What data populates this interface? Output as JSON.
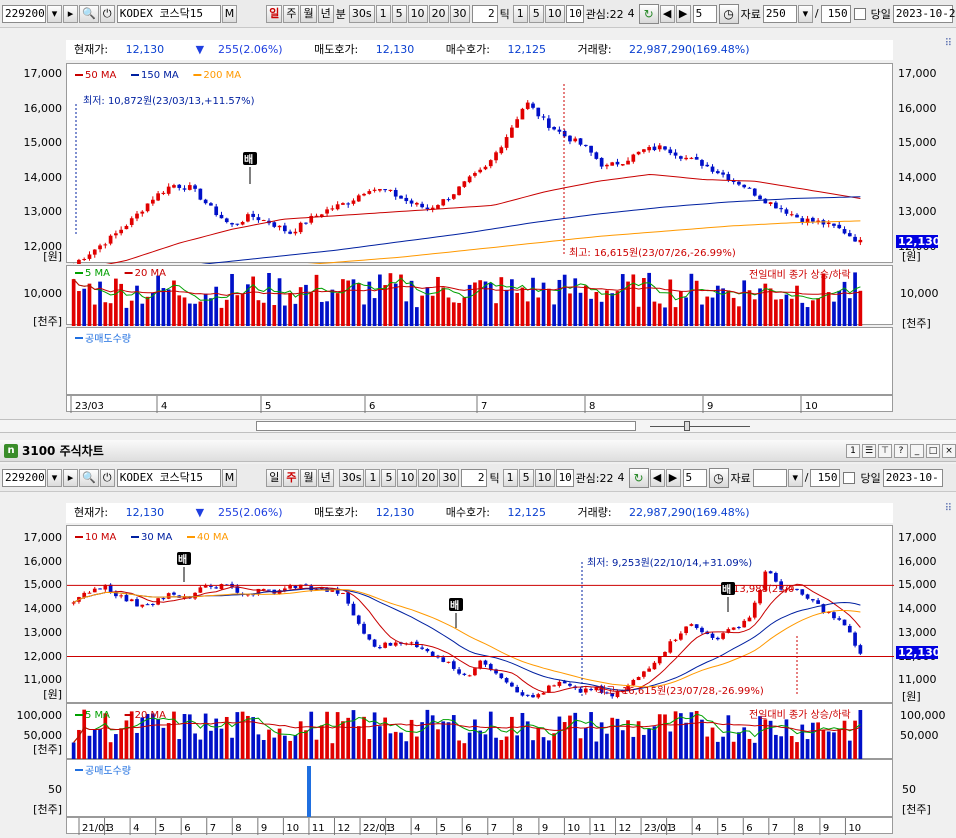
{
  "toolbar": {
    "code": "229200",
    "name": "KODEX 코스닥15",
    "periods": [
      "일",
      "주",
      "월",
      "년"
    ],
    "unit_min": "분",
    "mins": [
      "30s",
      "1",
      "5",
      "10",
      "20",
      "30"
    ],
    "tick_value": "2",
    "tick_label": "틱",
    "ticks": [
      "1",
      "5",
      "10"
    ],
    "interest_label": "관심:22",
    "interest_sub": "4",
    "count": "5",
    "data_label": "자료",
    "data_value": "250",
    "slash": "/",
    "display_value": "150",
    "today": "당일",
    "date": "2023-10-2"
  },
  "toolbar2": {
    "count": "5",
    "data_label": "자료",
    "display_value": "150",
    "date": "2023-10-"
  },
  "info": {
    "price_label": "현재가:",
    "price": "12,130",
    "change": "255(2.06%)",
    "ask_label": "매도호가:",
    "ask": "12,130",
    "bid_label": "매수호가:",
    "bid": "12,125",
    "vol_label": "거래량:",
    "vol": "22,987,290(169.48%)"
  },
  "window_title": "3100 주식차트",
  "window_logo": "n",
  "top": {
    "legend": [
      {
        "name": "50 MA",
        "color": "#c80000"
      },
      {
        "name": "150 MA",
        "color": "#0020a0"
      },
      {
        "name": "200 MA",
        "color": "#ff9900"
      }
    ],
    "low_note": "최저: 10,872원(23/03/13,+11.57%)",
    "high_note": "최고: 16,615원(23/07/26,-26.99%)",
    "yticks": [
      "17,000",
      "16,000",
      "15,000",
      "14,000",
      "13,000",
      "12,000"
    ],
    "unit": "[원]",
    "price_tag": "12,130",
    "vol_legend": [
      {
        "name": "5 MA",
        "color": "#00a000"
      },
      {
        "name": "20 MA",
        "color": "#c80000"
      }
    ],
    "vol_note": "전일대비 종가 상승/하락",
    "vol_tick": "10,000",
    "vol_unit": "[천주]",
    "short_label": "공매도수량",
    "xlabels": [
      "23/03",
      "4",
      "5",
      "6",
      "7",
      "8",
      "9",
      "10"
    ],
    "marker": "배"
  },
  "bottom": {
    "legend": [
      {
        "name": "10 MA",
        "color": "#c80000"
      },
      {
        "name": "30 MA",
        "color": "#0020a0"
      },
      {
        "name": "40 MA",
        "color": "#ff9900"
      }
    ],
    "low_note": "최저: 9,253원(22/10/14,+31.09%)",
    "high_note": "최고: 16,615원(23/07/28,-26.99%)",
    "mid_note": "13,988(23/0",
    "yticks": [
      "17,000",
      "16,000",
      "15,000",
      "14,000",
      "13,000",
      "12,000",
      "11,000"
    ],
    "unit": "[원]",
    "price_tag": "12,130",
    "vol_legend": [
      {
        "name": "5 MA",
        "color": "#00a000"
      },
      {
        "name": "20 MA",
        "color": "#c80000"
      }
    ],
    "vol_note": "전일대비 종가 상승/하락",
    "vol_ticks": [
      "100,000",
      "50,000"
    ],
    "vol_unit": "[천주]",
    "short_label": "공매도수량",
    "short_tick": "50",
    "short_unit": "[천주]",
    "xlabels": [
      "21/01",
      "3",
      "4",
      "5",
      "6",
      "7",
      "8",
      "9",
      "10",
      "11",
      "12",
      "22/01",
      "3",
      "4",
      "5",
      "6",
      "7",
      "8",
      "9",
      "10",
      "11",
      "12",
      "23/01",
      "3",
      "4",
      "5",
      "6",
      "7",
      "8",
      "9",
      "10"
    ],
    "marker": "배"
  },
  "colors": {
    "up": "#e00000",
    "down": "#0010c8",
    "tag": "#0000e0"
  }
}
